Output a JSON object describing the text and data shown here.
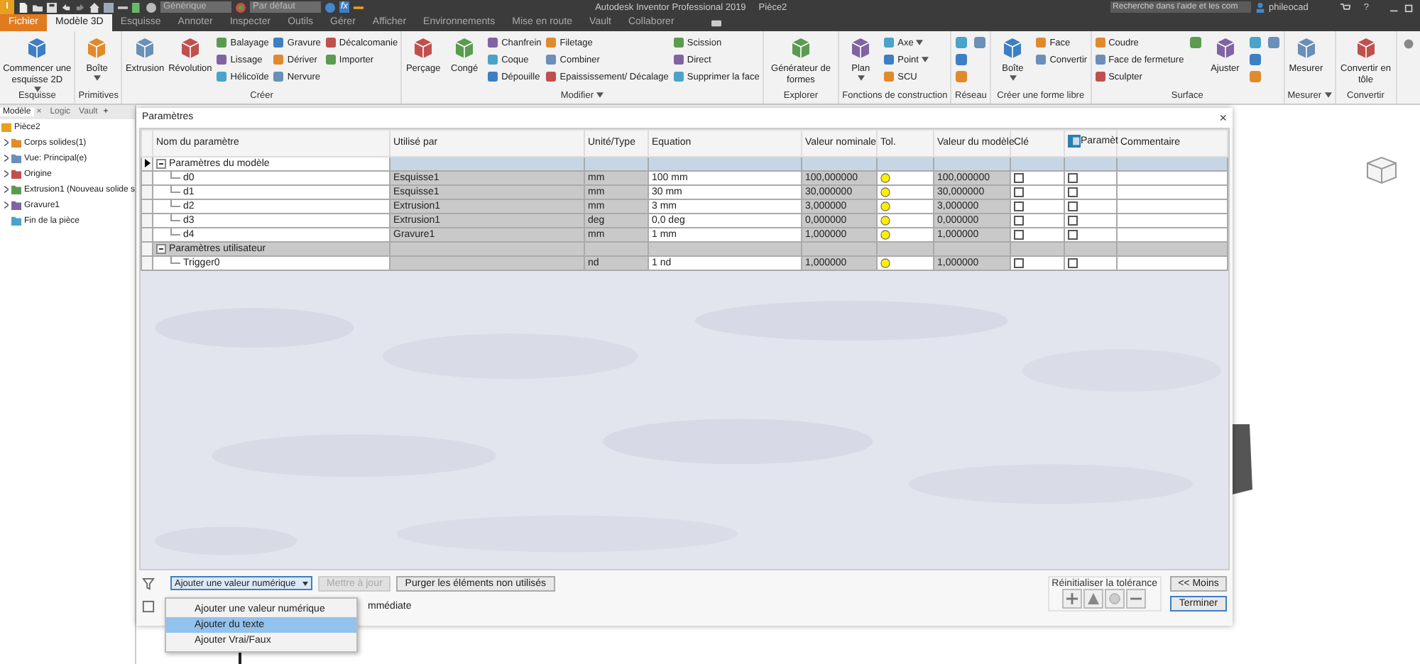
{
  "title_bar": {
    "logo": "I",
    "material": "Générique",
    "appearance": "Par défaut",
    "function_button": "fx",
    "app_title": "Autodesk Inventor Professional 2019",
    "document": "Pièce2",
    "search_placeholder": "Recherche dans l'aide et les com",
    "user": "phileocad",
    "help": "?"
  },
  "ribbon_tabs": [
    {
      "label": "Fichier",
      "kind": "file",
      "selected": false
    },
    {
      "label": "Modèle 3D",
      "kind": "tab",
      "selected": true
    },
    {
      "label": "Esquisse",
      "kind": "tab",
      "selected": false
    },
    {
      "label": "Annoter",
      "kind": "tab",
      "selected": false
    },
    {
      "label": "Inspecter",
      "kind": "tab",
      "selected": false
    },
    {
      "label": "Outils",
      "kind": "tab",
      "selected": false
    },
    {
      "label": "Gérer",
      "kind": "tab",
      "selected": false
    },
    {
      "label": "Afficher",
      "kind": "tab",
      "selected": false
    },
    {
      "label": "Environnements",
      "kind": "tab",
      "selected": false
    },
    {
      "label": "Mise en route",
      "kind": "tab",
      "selected": false
    },
    {
      "label": "Vault",
      "kind": "tab",
      "selected": false
    },
    {
      "label": "Collaborer",
      "kind": "tab",
      "selected": false
    }
  ],
  "ribbon_panels": [
    {
      "label": "Esquisse",
      "has_menu": false,
      "tools": [
        {
          "label": "Commencer une esquisse 2D",
          "kind": "large",
          "menu": true
        }
      ]
    },
    {
      "label": "Primitives",
      "has_menu": false,
      "tools": [
        {
          "label": "Boîte",
          "kind": "large",
          "menu": true
        }
      ]
    },
    {
      "label": "Créer",
      "has_menu": false,
      "tools": [
        {
          "label": "Extrusion",
          "kind": "large",
          "menu": false
        },
        {
          "label": "Révolution",
          "kind": "large",
          "menu": false
        },
        {
          "label": "Balayage",
          "kind": "small",
          "menu": false
        },
        {
          "label": "Lissage",
          "kind": "small",
          "menu": false
        },
        {
          "label": "Hélicoïde",
          "kind": "small",
          "menu": false
        },
        {
          "label": "Gravure",
          "kind": "small",
          "menu": false
        },
        {
          "label": "Dériver",
          "kind": "small",
          "menu": false
        },
        {
          "label": "Nervure",
          "kind": "small",
          "menu": false
        },
        {
          "label": "Décalcomanie",
          "kind": "small",
          "menu": false
        },
        {
          "label": "Importer",
          "kind": "small",
          "menu": false
        }
      ]
    },
    {
      "label": "Modifier",
      "has_menu": true,
      "tools": [
        {
          "label": "Perçage",
          "kind": "large",
          "menu": false
        },
        {
          "label": "Congé",
          "kind": "large",
          "menu": false
        },
        {
          "label": "Chanfrein",
          "kind": "small",
          "menu": false
        },
        {
          "label": "Coque",
          "kind": "small",
          "menu": false
        },
        {
          "label": "Dépouille",
          "kind": "small",
          "menu": false
        },
        {
          "label": "Filetage",
          "kind": "small",
          "menu": false
        },
        {
          "label": "Combiner",
          "kind": "small",
          "menu": false
        },
        {
          "label": "Epaississement/ Décalage",
          "kind": "small",
          "menu": false
        },
        {
          "label": "Scission",
          "kind": "small",
          "menu": false
        },
        {
          "label": "Direct",
          "kind": "small",
          "menu": false
        },
        {
          "label": "Supprimer la face",
          "kind": "small",
          "menu": false
        }
      ]
    },
    {
      "label": "Explorer",
      "has_menu": false,
      "tools": [
        {
          "label": "Générateur de formes",
          "kind": "large",
          "menu": false
        }
      ]
    },
    {
      "label": "Fonctions de construction",
      "has_menu": false,
      "tools": [
        {
          "label": "Plan",
          "kind": "large",
          "menu": true
        },
        {
          "label": "Axe",
          "kind": "small",
          "menu": true
        },
        {
          "label": "Point",
          "kind": "small",
          "menu": true
        },
        {
          "label": "SCU",
          "kind": "small",
          "menu": false
        }
      ]
    },
    {
      "label": "Réseau",
      "has_menu": false,
      "tools": [
        {
          "kind": "icon"
        },
        {
          "kind": "icon"
        },
        {
          "kind": "icon"
        },
        {
          "kind": "icon"
        }
      ]
    },
    {
      "label": "Créer une forme libre",
      "has_menu": false,
      "tools": [
        {
          "label": "Boîte",
          "kind": "large",
          "menu": true
        },
        {
          "label": "Face",
          "kind": "small",
          "menu": false
        },
        {
          "label": "Convertir",
          "kind": "small",
          "menu": false
        }
      ]
    },
    {
      "label": "Surface",
      "has_menu": false,
      "tools": [
        {
          "label": "Coudre",
          "kind": "small",
          "menu": false
        },
        {
          "label": "Face de fermeture",
          "kind": "small",
          "menu": false
        },
        {
          "label": "Sculpter",
          "kind": "small",
          "menu": false
        },
        {
          "kind": "icon"
        },
        {
          "label": "Ajuster",
          "kind": "large",
          "menu": false
        },
        {
          "kind": "icon"
        },
        {
          "kind": "icon"
        },
        {
          "kind": "icon"
        },
        {
          "kind": "icon"
        }
      ]
    },
    {
      "label": "Mesurer",
      "has_menu": true,
      "tools": [
        {
          "label": "Mesurer",
          "kind": "large",
          "menu": false
        }
      ]
    },
    {
      "label": "Convertir",
      "has_menu": false,
      "tools": [
        {
          "label": "Convertir en tôle",
          "kind": "large",
          "menu": false
        }
      ]
    }
  ],
  "browser": {
    "tabs": [
      {
        "label": "Modèle",
        "selected": true,
        "close": "×"
      },
      {
        "label": "Logic",
        "selected": false
      },
      {
        "label": "Vault",
        "selected": false
      }
    ],
    "add": "+",
    "tree": {
      "label": "Pièce2",
      "expanded": true,
      "children": [
        {
          "label": "Corps solides(1)",
          "expandable": true
        },
        {
          "label": "Vue: Principal(e)",
          "expandable": true
        },
        {
          "label": "Origine",
          "expandable": true
        },
        {
          "label": "Extrusion1 (Nouveau solide s",
          "expandable": true
        },
        {
          "label": "Gravure1",
          "expandable": true
        },
        {
          "label": "Fin de la pièce",
          "expandable": false
        }
      ]
    }
  },
  "dialog": {
    "title": "Paramètres",
    "close": "×",
    "columns": [
      "Nom du paramètre",
      "Utilisé par",
      "Unité/Type",
      "Equation",
      "Valeur nominale",
      "Tol.",
      "Valeur du modèle",
      "Clé",
      "Paramèt",
      "Commentaire"
    ],
    "groups": [
      {
        "name": "Paramètres du modèle",
        "expanded": true,
        "selected": true,
        "rows": [
          {
            "name": "d0",
            "used_by": "Esquisse1",
            "unit": "mm",
            "equation": "100 mm",
            "nominal": "100,000000",
            "model_value": "100,000000",
            "key": false,
            "export": false
          },
          {
            "name": "d1",
            "used_by": "Esquisse1",
            "unit": "mm",
            "equation": "30 mm",
            "nominal": "30,000000",
            "model_value": "30,000000",
            "key": false,
            "export": false
          },
          {
            "name": "d2",
            "used_by": "Extrusion1",
            "unit": "mm",
            "equation": "3 mm",
            "nominal": "3,000000",
            "model_value": "3,000000",
            "key": false,
            "export": false
          },
          {
            "name": "d3",
            "used_by": "Extrusion1",
            "unit": "deg",
            "equation": "0,0 deg",
            "nominal": "0,000000",
            "model_value": "0,000000",
            "key": false,
            "export": false
          },
          {
            "name": "d4",
            "used_by": "Gravure1",
            "unit": "mm",
            "equation": "1 mm",
            "nominal": "1,000000",
            "model_value": "1,000000",
            "key": false,
            "export": false
          }
        ]
      },
      {
        "name": "Paramètres utilisateur",
        "expanded": true,
        "selected": false,
        "rows": [
          {
            "name": "Trigger0",
            "used_by": "",
            "unit": "nd",
            "equation": "1 nd",
            "nominal": "1,000000",
            "model_value": "1,000000",
            "key": false,
            "export": false
          }
        ]
      }
    ],
    "add_dropdown": "Ajouter une valeur numérique",
    "update_button": {
      "label": "Mettre à jour",
      "disabled": true
    },
    "purge_button": "Purger les éléments non utilisés",
    "immediate_label": "mmédiate",
    "tolerance_label": "Réinitialiser la tolérance",
    "less_button": "<< Moins",
    "done_button": "Terminer",
    "dropdown_menu": [
      {
        "label": "Ajouter une valeur numérique",
        "selected": false
      },
      {
        "label": "Ajouter du texte",
        "selected": true
      },
      {
        "label": "Ajouter Vrai/Faux",
        "selected": false
      }
    ]
  }
}
